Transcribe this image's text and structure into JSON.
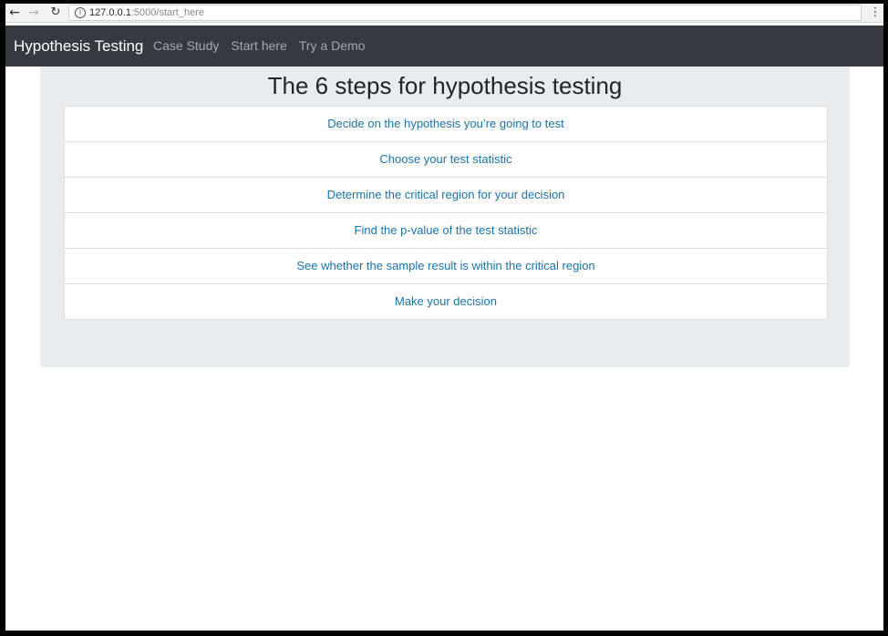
{
  "browser": {
    "info_icon": "info-icon",
    "url_host": "127.0.0.1",
    "url_path": ":5000/start_here"
  },
  "navbar": {
    "brand": "Hypothesis Testing",
    "links": [
      {
        "label": "Case Study"
      },
      {
        "label": "Start here"
      },
      {
        "label": "Try a Demo"
      }
    ]
  },
  "main": {
    "title": "The 6 steps for hypothesis testing",
    "steps": [
      {
        "label": "Decide on the hypothesis you’re going to test"
      },
      {
        "label": "Choose your test statistic"
      },
      {
        "label": "Determine the critical region for your decision"
      },
      {
        "label": "Find the p-value of the test statistic"
      },
      {
        "label": "See whether the sample result is within the critical region"
      },
      {
        "label": "Make your decision"
      }
    ]
  },
  "colors": {
    "navbar_bg": "#343a40",
    "jumbotron_bg": "#e9ecef",
    "link": "#1a73a8"
  }
}
